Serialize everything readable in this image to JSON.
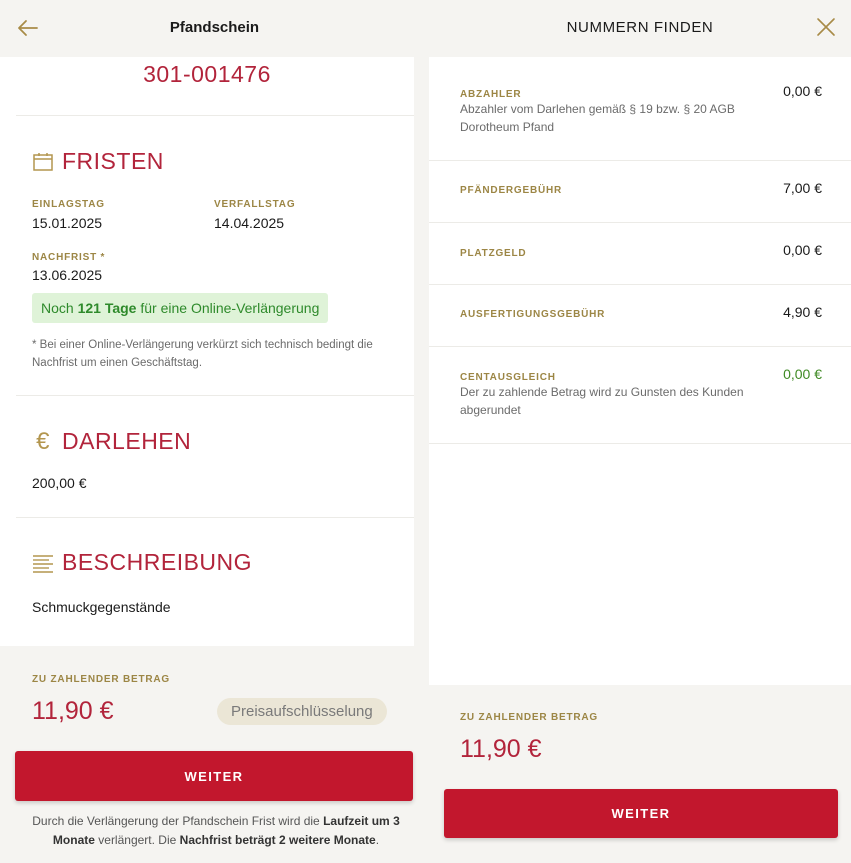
{
  "left": {
    "header": {
      "title": "Pfandschein"
    },
    "pfandschein_number": "301-001476",
    "fristen": {
      "title": "FRISTEN",
      "einlagstag_label": "EINLAGSTAG",
      "einlagstag_value": "15.01.2025",
      "verfallstag_label": "VERFALLSTAG",
      "verfallstag_value": "14.04.2025",
      "nachfrist_label": "NACHFRIST *",
      "nachfrist_value": "13.06.2025",
      "badge_prefix": "Noch",
      "badge_bold": "121 Tage",
      "badge_suffix": "für eine Online-Verlängerung",
      "note": "* Bei einer Online-Verlängerung verkürzt sich technisch bedingt die Nachfrist um einen Geschäftstag."
    },
    "darlehen": {
      "title": "DARLEHEN",
      "value": "200,00 €"
    },
    "beschreibung": {
      "title": "BESCHREIBUNG",
      "value": "Schmuckgegenstände"
    },
    "payment": {
      "label": "ZU ZAHLENDER BETRAG",
      "amount": "11,90 €",
      "breakdown_button": "Preisaufschlüsselung"
    },
    "weiter_button": "WEITER",
    "footer": {
      "part1": "Durch die Verlängerung der Pfandschein Frist wird die",
      "part2_bold": "Laufzeit um 3 Monate",
      "part3": "verlängert. Die",
      "part4_bold": "Nachfrist beträgt 2 weitere Monate",
      "part5": "."
    }
  },
  "right": {
    "header": {
      "title": "NUMMERN FINDEN"
    },
    "items": [
      {
        "label": "ABZAHLER",
        "description": "Abzahler vom Darlehen gemäß § 19 bzw. § 20 AGB Dorotheum Pfand",
        "amount": "0,00 €"
      },
      {
        "label": "PFÄNDERGEBÜHR",
        "description": "",
        "amount": "7,00 €"
      },
      {
        "label": "PLATZGELD",
        "description": "",
        "amount": "0,00 €"
      },
      {
        "label": "AUSFERTIGUNGSGEBÜHR",
        "description": "",
        "amount": "4,90 €"
      },
      {
        "label": "CENTAUSGLEICH",
        "description": "Der zu zahlende Betrag wird zu Gunsten des Kunden abgerundet",
        "amount": "0,00 €"
      }
    ],
    "payment": {
      "label": "ZU ZAHLENDER BETRAG",
      "amount": "11,90 €"
    },
    "weiter_button": "WEITER"
  },
  "colors": {
    "accent_red": "#b2243b",
    "button_red": "#c2172d",
    "gold": "#9c8645",
    "green": "#2e8a2b",
    "badge_bg": "#dff3d8"
  },
  "icons": [
    "back-arrow-icon",
    "close-icon",
    "calendar-icon",
    "euro-icon",
    "lines-icon"
  ]
}
